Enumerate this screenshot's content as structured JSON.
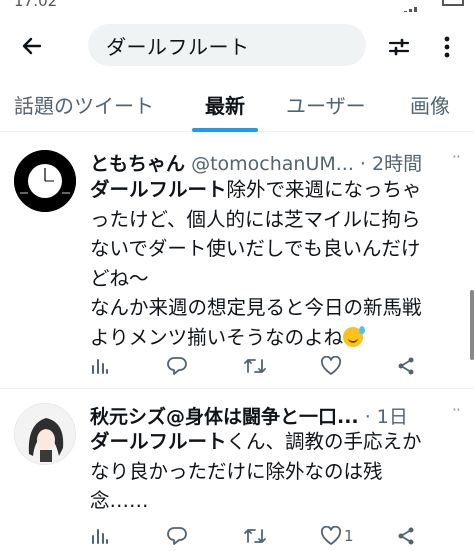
{
  "status_bar": {
    "time": "17:02"
  },
  "header": {
    "search_query": "ダールフルート",
    "icons": {
      "back": "arrow-left-icon",
      "filter": "sliders-icon",
      "more": "more-vertical-icon"
    }
  },
  "tabs": [
    {
      "label": "話題のツイート",
      "active": false
    },
    {
      "label": "最新",
      "active": true
    },
    {
      "label": "ユーザー",
      "active": false
    },
    {
      "label": "画像",
      "active": false
    }
  ],
  "accent_color": "#1d9bf0",
  "tweets": [
    {
      "display_name": "ともちゃん",
      "handle": "@tomochanUM...",
      "time": "· 2時間",
      "more": "··",
      "body": {
        "l1_bold": "ダールフルート",
        "l1_rest": "除外で来週になっちゃ",
        "l2": "ったけど、個人的には芝マイルに拘ら",
        "l3": "ないでダート使いだしでも良いんだけ",
        "l4": "どね〜",
        "l5": "なんか来週の想定見ると今日の新馬戦",
        "l6": "よりメンツ揃いそうなのよね"
      },
      "emoji": "grinning-sweat-emoji",
      "like_count": ""
    },
    {
      "display_name": "秋元シズ@身体は闘争と一口...",
      "handle": "",
      "time": "· 1日",
      "more": "··",
      "body": {
        "l1_bold": "ダールフルート",
        "l1_rest": "くん、調教の手応えか",
        "l2": "なり良かっただけに除外なのは残",
        "l3": "念……"
      },
      "like_count": "1"
    }
  ]
}
